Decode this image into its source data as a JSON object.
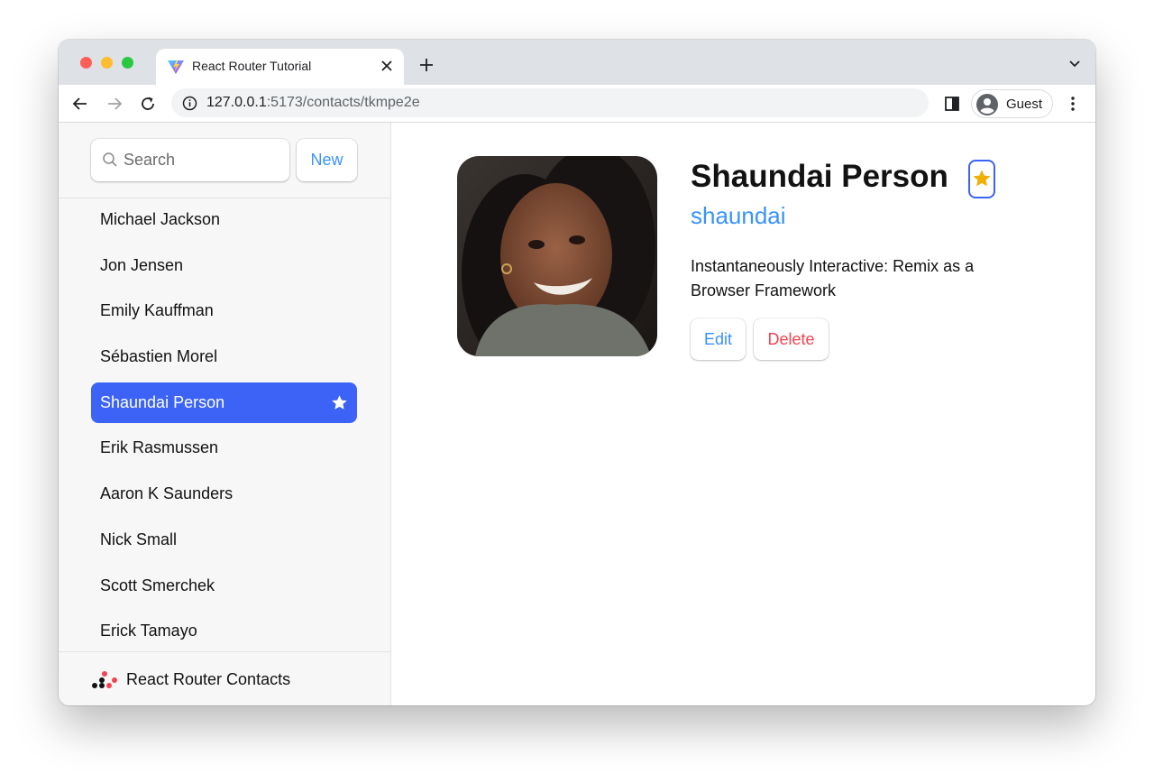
{
  "browser": {
    "tab_title": "React Router Tutorial",
    "url_host": "127.0.0.1",
    "url_rest": ":5173/contacts/tkmpe2e",
    "profile_name": "Guest"
  },
  "sidebar": {
    "search_placeholder": "Search",
    "new_label": "New",
    "contacts": [
      {
        "name": "Michael Jackson",
        "favorite": false,
        "active": false
      },
      {
        "name": "Jon Jensen",
        "favorite": false,
        "active": false
      },
      {
        "name": "Emily Kauffman",
        "favorite": false,
        "active": false
      },
      {
        "name": "Sébastien Morel",
        "favorite": false,
        "active": false
      },
      {
        "name": "Shaundai Person",
        "favorite": true,
        "active": true
      },
      {
        "name": "Erik Rasmussen",
        "favorite": false,
        "active": false
      },
      {
        "name": "Aaron K Saunders",
        "favorite": false,
        "active": false
      },
      {
        "name": "Nick Small",
        "favorite": false,
        "active": false
      },
      {
        "name": "Scott Smerchek",
        "favorite": false,
        "active": false
      },
      {
        "name": "Erick Tamayo",
        "favorite": false,
        "active": false
      }
    ],
    "footer_brand": "React Router Contacts"
  },
  "contact": {
    "name": "Shaundai Person",
    "favorite": true,
    "twitter": "shaundai",
    "notes": "Instantaneously Interactive: Remix as a Browser Framework",
    "edit_label": "Edit",
    "delete_label": "Delete"
  },
  "colors": {
    "accent": "#3c63f6",
    "link": "#3992ff",
    "danger": "#f44250",
    "star": "#eeb004"
  }
}
